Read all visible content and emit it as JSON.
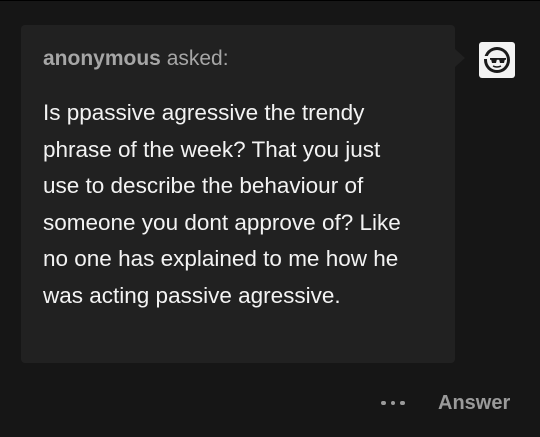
{
  "ask": {
    "asker_name": "anonymous",
    "asked_label": "asked:",
    "question_lines": [
      "Is ppassive agressive the trendy",
      "phrase of the week? That you just",
      "use to describe the behaviour of",
      "someone you dont approve of? Like",
      "no one has explained to me how he",
      "was acting passive agressive."
    ]
  },
  "avatar": {
    "icon": "sunglasses-face-icon"
  },
  "footer": {
    "more_icon": "ellipsis-icon",
    "answer_label": "Answer"
  },
  "colors": {
    "background": "#161616",
    "card": "#212121",
    "text": "#f3f3f3",
    "muted": "#a6a6a6"
  }
}
